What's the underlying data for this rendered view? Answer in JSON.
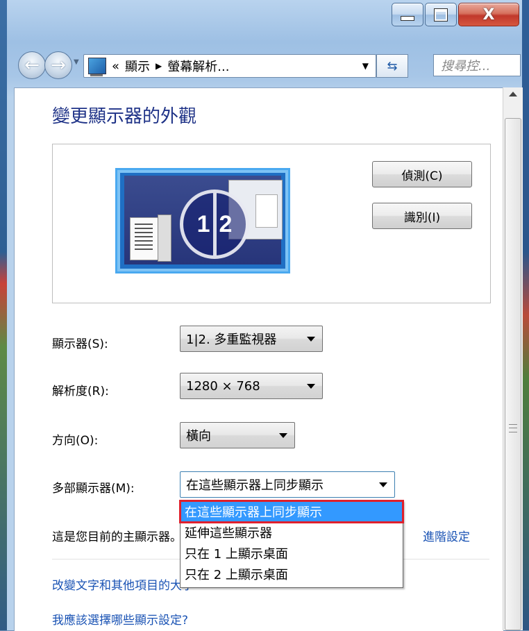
{
  "window": {
    "caption_buttons": {
      "minimize": "minimize-button",
      "maximize": "maximize-button",
      "close_label": "X"
    }
  },
  "navbar": {
    "back_icon": "back-arrow-icon",
    "forward_icon": "forward-arrow-icon",
    "address": {
      "prefix": "«",
      "segments": [
        "顯示",
        "螢幕解析..."
      ],
      "separator": "▶"
    },
    "search_placeholder": "搜尋控..."
  },
  "main": {
    "title": "變更顯示器的外觀",
    "monitor_preview": {
      "identity_labels": [
        "1",
        "2"
      ]
    },
    "buttons": {
      "detect": "偵測(C)",
      "identify": "識別(I)"
    },
    "settings": [
      {
        "label": "顯示器(S):",
        "value": "1|2. 多重監視器"
      },
      {
        "label": "解析度(R):",
        "value": "1280 × 768"
      },
      {
        "label": "方向(O):",
        "value": "橫向"
      },
      {
        "label": "多部顯示器(M):",
        "value": "在這些顯示器上同步顯示"
      }
    ],
    "multi_display_options": [
      "在這些顯示器上同步顯示",
      "延伸這些顯示器",
      "只在 1 上顯示桌面",
      "只在 2 上顯示桌面"
    ],
    "selected_option_index": 0,
    "info_text": "這是您目前的主顯示器。",
    "advanced_link": "進階設定",
    "link_text_size": "改變文字和其他項目的大小",
    "link_which_settings": "我應該選擇哪些顯示設定?"
  },
  "colors": {
    "link": "#1a53b4",
    "title": "#1e3287",
    "selection": "#3399ff",
    "highlight_box": "#e0202c"
  }
}
